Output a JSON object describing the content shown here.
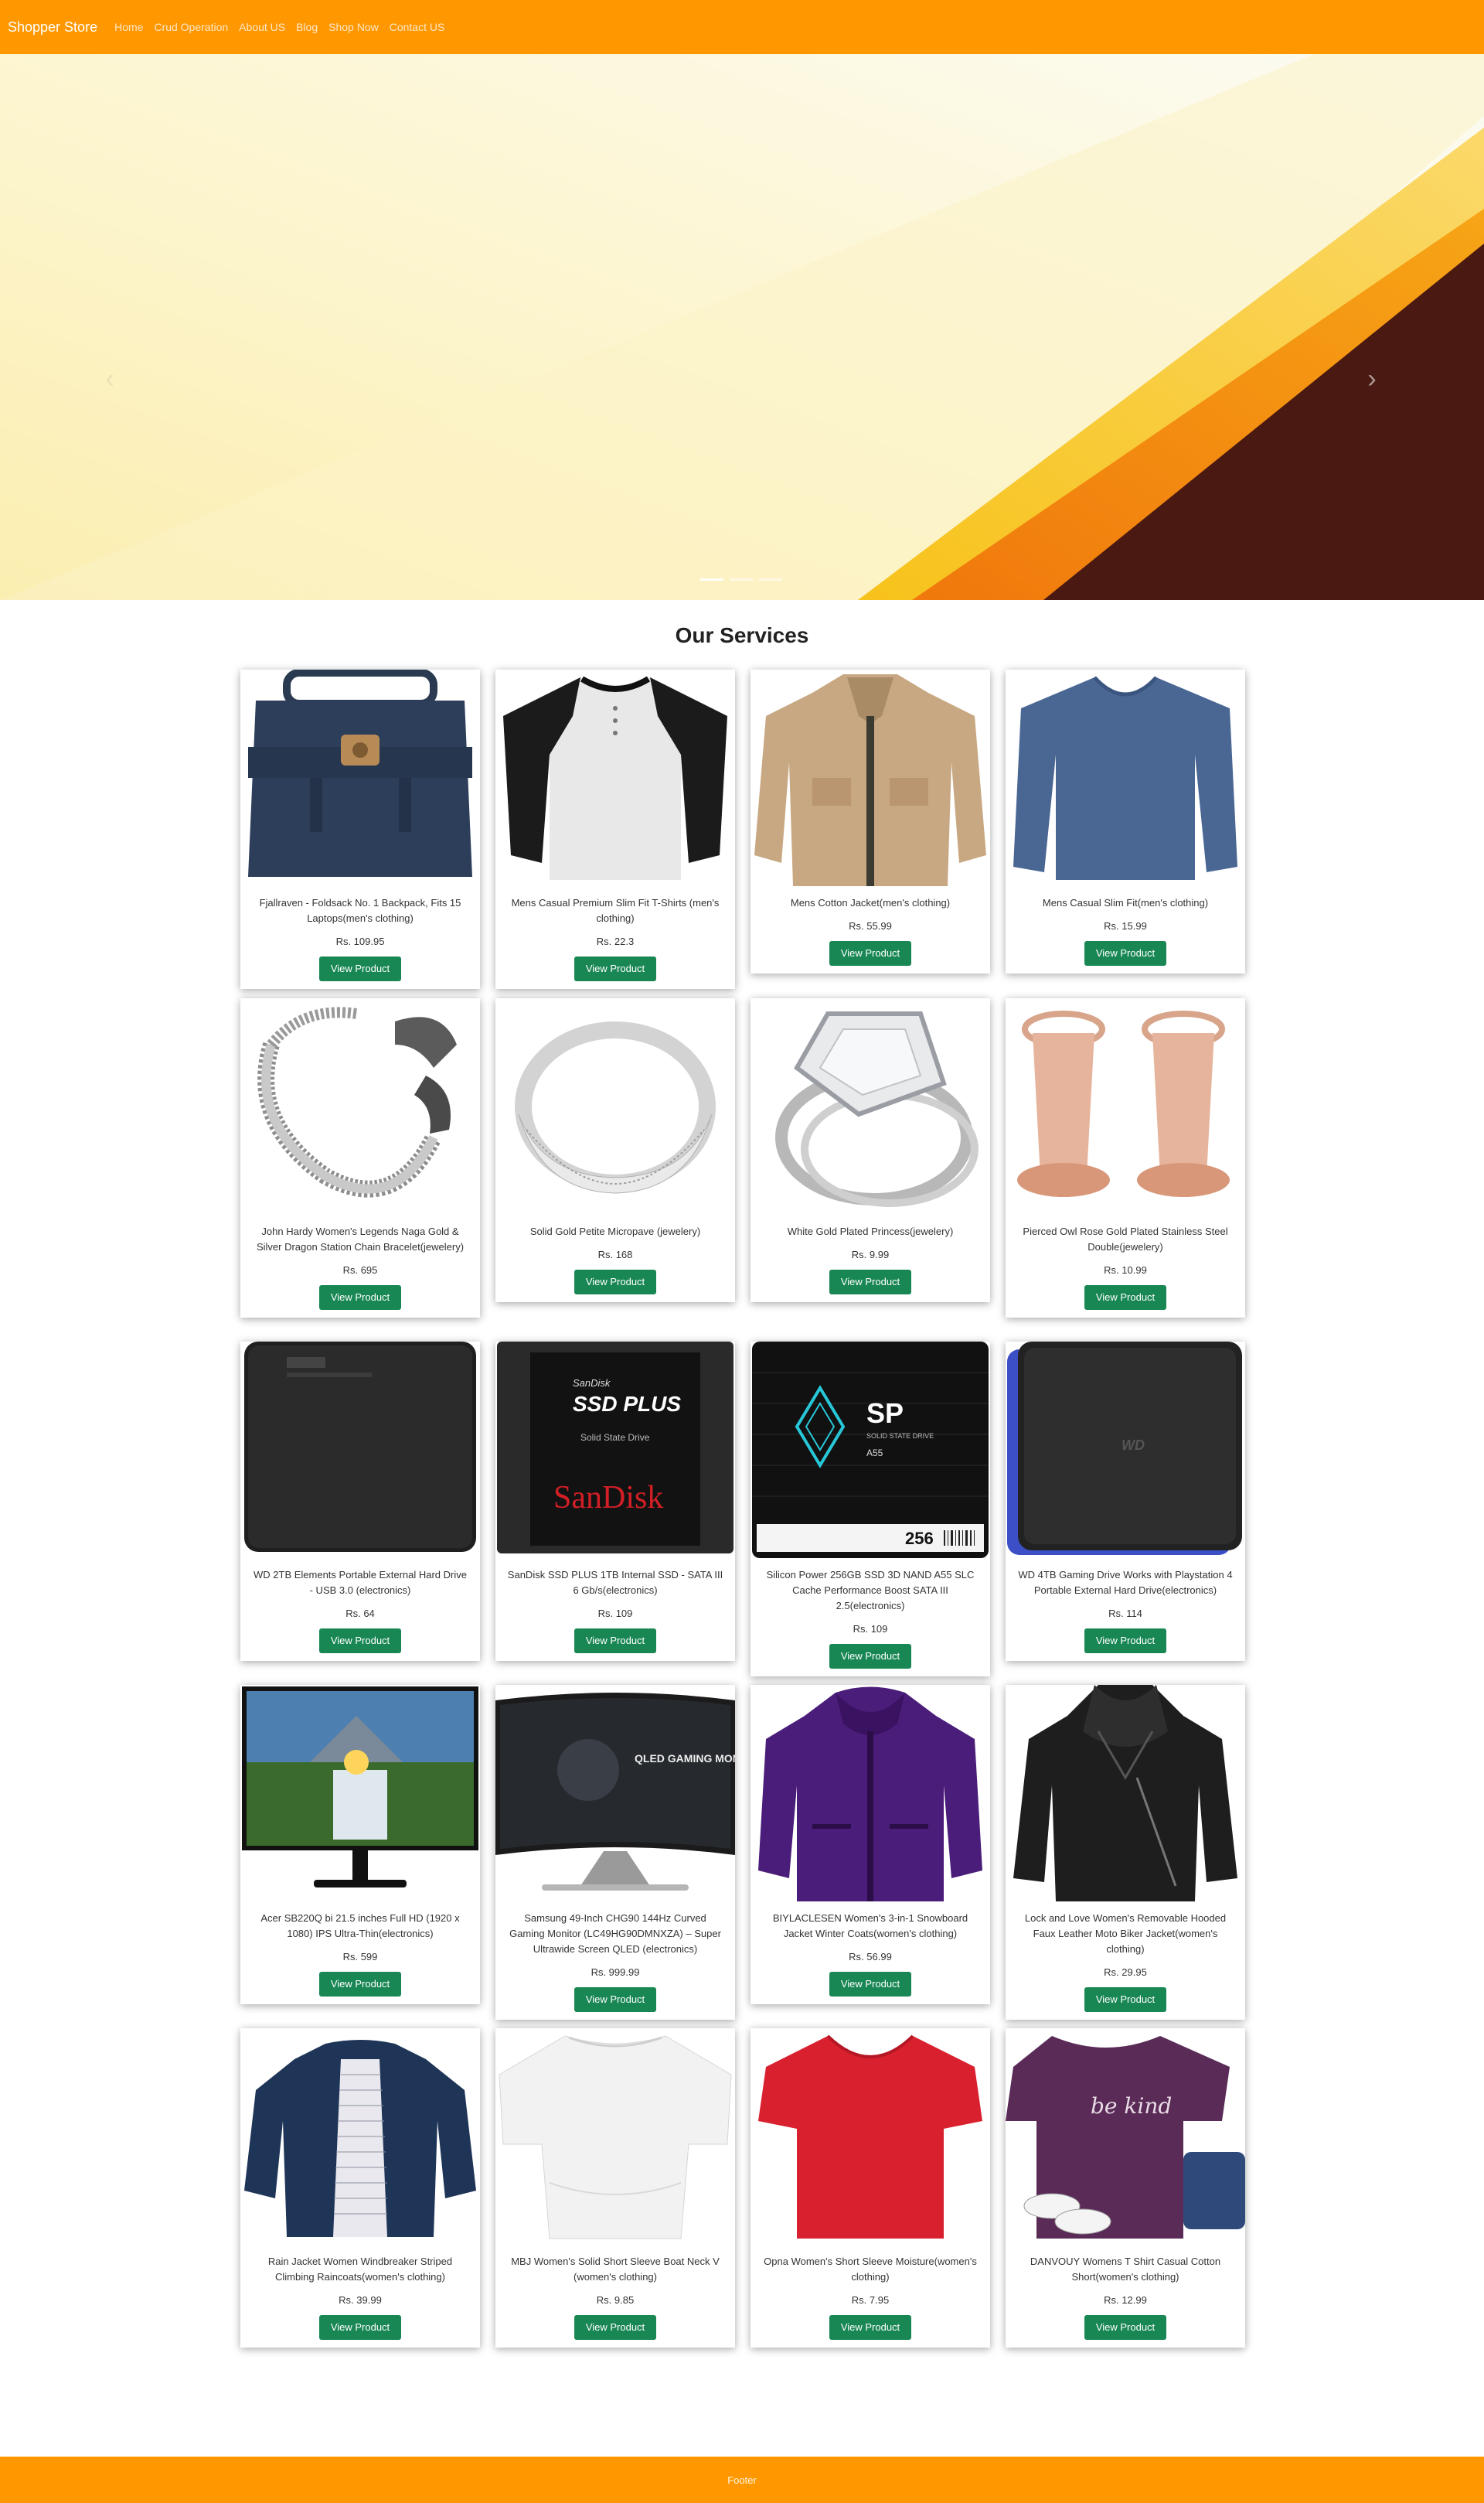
{
  "navbar": {
    "brand": "Shopper Store",
    "links": [
      "Home",
      "Crud Operation",
      "About US",
      "Blog",
      "Shop Now",
      "Contact US"
    ]
  },
  "hero": {
    "prev_icon": "chevron-left-icon",
    "next_icon": "chevron-right-icon",
    "slides": 3,
    "active_slide": 1
  },
  "services": {
    "title": "Our Services",
    "button_label": "View Product",
    "products": [
      {
        "title": "Fjallraven - Foldsack No. 1 Backpack, Fits 15 Laptops(men's clothing)",
        "price": "Rs. 109.95"
      },
      {
        "title": "Mens Casual Premium Slim Fit T-Shirts (men's clothing)",
        "price": "Rs. 22.3"
      },
      {
        "title": "Mens Cotton Jacket(men's clothing)",
        "price": "Rs. 55.99"
      },
      {
        "title": "Mens Casual Slim Fit(men's clothing)",
        "price": "Rs. 15.99"
      },
      {
        "title": "John Hardy Women's Legends Naga Gold & Silver Dragon Station Chain Bracelet(jewelery)",
        "price": "Rs. 695"
      },
      {
        "title": "Solid Gold Petite Micropave (jewelery)",
        "price": "Rs. 168"
      },
      {
        "title": "White Gold Plated Princess(jewelery)",
        "price": "Rs. 9.99"
      },
      {
        "title": "Pierced Owl Rose Gold Plated Stainless Steel Double(jewelery)",
        "price": "Rs. 10.99"
      },
      {
        "title": "WD 2TB Elements Portable External Hard Drive - USB 3.0 (electronics)",
        "price": "Rs. 64"
      },
      {
        "title": "SanDisk SSD PLUS 1TB Internal SSD - SATA III 6 Gb/s(electronics)",
        "price": "Rs. 109"
      },
      {
        "title": "Silicon Power 256GB SSD 3D NAND A55 SLC Cache Performance Boost SATA III 2.5(electronics)",
        "price": "Rs. 109"
      },
      {
        "title": "WD 4TB Gaming Drive Works with Playstation 4 Portable External Hard Drive(electronics)",
        "price": "Rs. 114"
      },
      {
        "title": "Acer SB220Q bi 21.5 inches Full HD (1920 x 1080) IPS Ultra-Thin(electronics)",
        "price": "Rs. 599"
      },
      {
        "title": "Samsung 49-Inch CHG90 144Hz Curved Gaming Monitor (LC49HG90DMNXZA) – Super Ultrawide Screen QLED (electronics)",
        "price": "Rs. 999.99"
      },
      {
        "title": "BIYLACLESEN Women's 3-in-1 Snowboard Jacket Winter Coats(women's clothing)",
        "price": "Rs. 56.99"
      },
      {
        "title": "Lock and Love Women's Removable Hooded Faux Leather Moto Biker Jacket(women's clothing)",
        "price": "Rs. 29.95"
      },
      {
        "title": "Rain Jacket Women Windbreaker Striped Climbing Raincoats(women's clothing)",
        "price": "Rs. 39.99"
      },
      {
        "title": "MBJ Women's Solid Short Sleeve Boat Neck V (women's clothing)",
        "price": "Rs. 9.85"
      },
      {
        "title": "Opna Women's Short Sleeve Moisture(women's clothing)",
        "price": "Rs. 7.95"
      },
      {
        "title": "DANVOUY Womens T Shirt Casual Cotton Short(women's clothing)",
        "price": "Rs. 12.99"
      }
    ],
    "image_text": {
      "ssd_brand_top": "SanDisk",
      "ssd_title": "SSD PLUS",
      "ssd_sub": "Solid State Drive",
      "ssd_logo": "SanDisk",
      "sp_logo": "SP",
      "sp_sub": "SOLID STATE DRIVE",
      "sp_model": "A55",
      "sp_cap": "256",
      "wd_logo": "WD",
      "monitor_text": "QLED GAMING MONITOR",
      "tee_text": "be kind"
    }
  },
  "footer": {
    "text": "Footer"
  },
  "colors": {
    "nav": "#ff9800",
    "button": "#198754",
    "footer": "#ff9800"
  }
}
